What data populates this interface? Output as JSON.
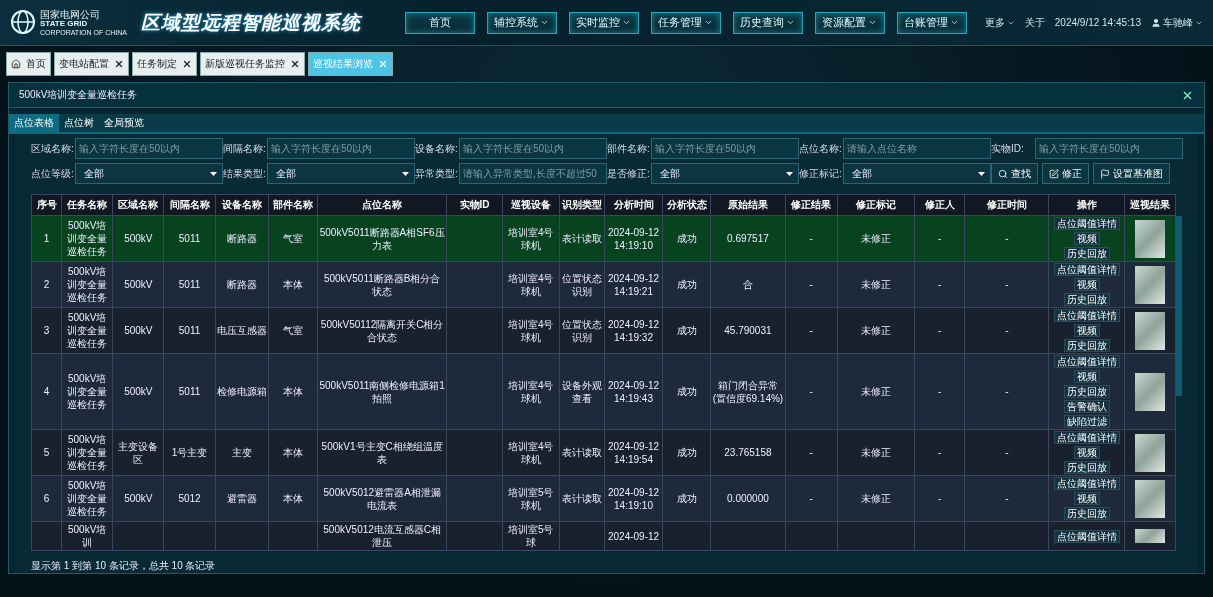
{
  "header": {
    "logo": {
      "name_cn": "国家电网公司",
      "name_en": "STATE GRID",
      "subtitle": "CORPORATION OF CHINA"
    },
    "title": "区域型远程智能巡视系统",
    "nav": [
      {
        "label": "首页",
        "dropdown": false
      },
      {
        "label": "辅控系统",
        "dropdown": true
      },
      {
        "label": "实时监控",
        "dropdown": true
      },
      {
        "label": "任务管理",
        "dropdown": true
      },
      {
        "label": "历史查询",
        "dropdown": true
      },
      {
        "label": "资源配置",
        "dropdown": true
      },
      {
        "label": "台账管理",
        "dropdown": true
      }
    ],
    "more": "更多",
    "about": "关于",
    "datetime": "2024/9/12 14:45:13",
    "user": "车驰峰"
  },
  "tabs": [
    {
      "label": "首页",
      "kind": "home",
      "selected": false,
      "closable": false
    },
    {
      "label": "变电站配置",
      "kind": "page",
      "selected": false,
      "closable": true
    },
    {
      "label": "任务制定",
      "kind": "page",
      "selected": false,
      "closable": true
    },
    {
      "label": "新版巡视任务监控",
      "kind": "page",
      "selected": false,
      "closable": true
    },
    {
      "label": "巡视结果浏览",
      "kind": "page",
      "selected": true,
      "closable": true
    }
  ],
  "panel": {
    "title": "500kV培训变全量巡检任务",
    "subtabs": [
      {
        "label": "点位表格",
        "selected": true
      },
      {
        "label": "点位树",
        "selected": false
      },
      {
        "label": "全局预览",
        "selected": false
      }
    ],
    "filters": [
      {
        "label": "区域名称:",
        "kind": "input",
        "placeholder": "输入字符长度在50以内"
      },
      {
        "label": "间隔名称:",
        "kind": "input",
        "placeholder": "输入字符长度在50以内"
      },
      {
        "label": "设备名称:",
        "kind": "input",
        "placeholder": "输入字符长度在50以内"
      },
      {
        "label": "部件名称:",
        "kind": "input",
        "placeholder": "输入字符长度在50以内"
      },
      {
        "label": "点位名称:",
        "kind": "input",
        "placeholder": "请输入点位名称"
      },
      {
        "label": "实物ID:",
        "kind": "input",
        "placeholder": "输入字符长度在50以内"
      },
      {
        "label": "点位等级:",
        "kind": "select",
        "value": "全部"
      },
      {
        "label": "结果类型:",
        "kind": "select",
        "value": "全部"
      },
      {
        "label": "异常类型:",
        "kind": "input",
        "placeholder": "请输入异常类型,长度不超过50"
      },
      {
        "label": "是否修正:",
        "kind": "select",
        "value": "全部"
      },
      {
        "label": "修正标记:",
        "kind": "select",
        "value": "全部"
      }
    ],
    "buttons": [
      {
        "label": "查找",
        "kind": "search"
      },
      {
        "label": "修正",
        "kind": "edit"
      },
      {
        "label": "设置基准图",
        "kind": "flag"
      }
    ],
    "table": {
      "columns": [
        "序号",
        "任务名称",
        "区域名称",
        "间隔名称",
        "设备名称",
        "部件名称",
        "点位名称",
        "实物ID",
        "巡视设备",
        "识别类型",
        "分析时间",
        "分析状态",
        "原始结果",
        "修正结果",
        "修正标记",
        "修正人",
        "修正时间",
        "操作",
        "巡视结果"
      ],
      "rows": [
        {
          "selected": true,
          "cells": [
            "1",
            "500kV培训变全量巡检任务",
            "500kV",
            "5011",
            "断路器",
            "气室",
            "500kV5011断路器A相SF6压力表",
            null,
            "培训室4号球机",
            "表计读取",
            "2024-09-12 14:19:10",
            "成功",
            "0.697517",
            "-",
            "未修正",
            "-",
            "-"
          ],
          "actions": [
            "点位阈值详情",
            "视频",
            "历史回放"
          ]
        },
        {
          "selected": false,
          "cells": [
            "2",
            "500kV培训变全量巡检任务",
            "500kV",
            "5011",
            "断路器",
            "本体",
            "500kV5011断路器B相分合状态",
            null,
            "培训室4号球机",
            "位置状态识别",
            "2024-09-12 14:19:21",
            "成功",
            "合",
            "-",
            "未修正",
            "-",
            "-"
          ],
          "actions": [
            "点位阈值详情",
            "视频",
            "历史回放"
          ]
        },
        {
          "selected": false,
          "cells": [
            "3",
            "500kV培训变全量巡检任务",
            "500kV",
            "5011",
            "电压互感器",
            "气室",
            "500kV50112隔离开关C相分合状态",
            null,
            "培训室4号球机",
            "位置状态识别",
            "2024-09-12 14:19:32",
            "成功",
            "45.790031",
            "-",
            "未修正",
            "-",
            "-"
          ],
          "actions": [
            "点位阈值详情",
            "视频",
            "历史回放"
          ]
        },
        {
          "selected": false,
          "cells": [
            "4",
            "500kV培训变全量巡检任务",
            "500kV",
            "5011",
            "检修电源箱",
            "本体",
            "500kV5011南侧检修电源箱1拍照",
            null,
            "培训室4号球机",
            "设备外观查看",
            "2024-09-12 14:19:43",
            "成功",
            "箱门闭合异常(置信度69.14%)",
            "-",
            "未修正",
            "-",
            "-"
          ],
          "actions": [
            "点位阈值详情",
            "视频",
            "历史回放",
            "告警确认",
            "缺陷过滤"
          ]
        },
        {
          "selected": false,
          "cells": [
            "5",
            "500kV培训变全量巡检任务",
            "主变设备区",
            "1号主变",
            "主变",
            "本体",
            "500kV1号主变C相绕组温度表",
            null,
            "培训室4号球机",
            "表计读取",
            "2024-09-12 14:19:54",
            "成功",
            "23.765158",
            "-",
            "未修正",
            "-",
            "-"
          ],
          "actions": [
            "点位阈值详情",
            "视频",
            "历史回放"
          ]
        },
        {
          "selected": false,
          "cells": [
            "6",
            "500kV培训变全量巡检任务",
            "500kV",
            "5012",
            "避雷器",
            "本体",
            "500kV5012避雷器A相泄漏电流表",
            null,
            "培训室5号球机",
            "表计读取",
            "2024-09-12 14:19:10",
            "成功",
            "0.000000",
            "-",
            "未修正",
            "-",
            "-"
          ],
          "actions": [
            "点位阈值详情",
            "视频",
            "历史回放"
          ]
        },
        {
          "selected": false,
          "cells": [
            null,
            "500kV培训",
            null,
            null,
            null,
            null,
            "500kV5012电流互感器C相泄压",
            null,
            "培训室5号球",
            null,
            "2024-09-12",
            null,
            null,
            null,
            null,
            null,
            null
          ],
          "actions": [
            "点位阈值详情"
          ]
        }
      ]
    },
    "footer": "显示第 1 到第 10 条记录，总共 10 条记录"
  }
}
